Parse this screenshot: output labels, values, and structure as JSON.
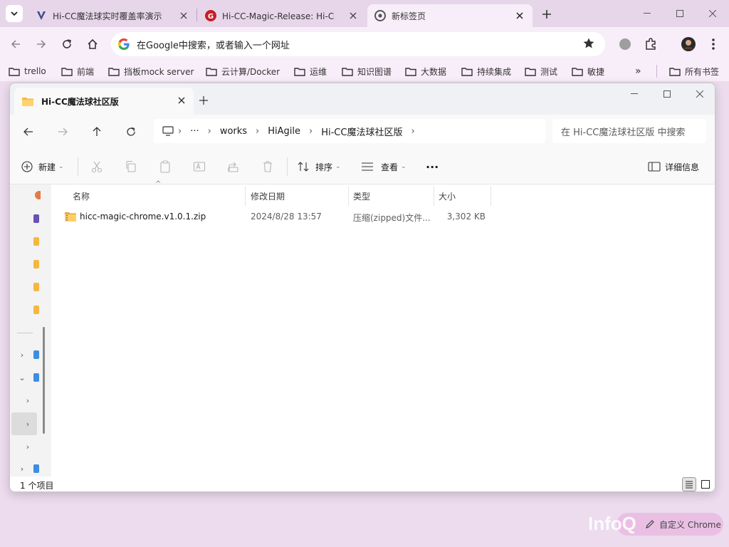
{
  "browser": {
    "tabs": [
      {
        "title": "Hi-CC魔法球实时覆盖率演示",
        "icon": "v-logo-icon",
        "color": "#3b4a8c"
      },
      {
        "title": "Hi-CC-Magic-Release: Hi-CC魔",
        "icon": "gitee-logo-icon",
        "color": "#c71d23"
      },
      {
        "title": "新标签页",
        "icon": "chrome-logo-icon",
        "color": "#555555"
      }
    ],
    "omnibox": {
      "text": "在Google中搜索，或者输入一个网址"
    },
    "bookmarks": [
      "trello",
      "前端",
      "挡板mock server",
      "云计算/Docker",
      "运维",
      "知识图谱",
      "大数据",
      "持续集成",
      "测试",
      "敏捷"
    ],
    "more_bookmarks": "»",
    "all_bookmarks": "所有书签",
    "accent": "#f8eef9"
  },
  "explorer": {
    "tab_title": "Hi-CC魔法球社区版",
    "breadcrumb": [
      "works",
      "HiAgile",
      "Hi-CC魔法球社区版"
    ],
    "breadcrumb_ellipsis": "···",
    "search_placeholder": "在 Hi-CC魔法球社区版 中搜索",
    "commands": {
      "new": "新建",
      "sort": "排序",
      "view": "查看",
      "more": "···",
      "details": "详细信息"
    },
    "columns": [
      "名称",
      "修改日期",
      "类型",
      "大小"
    ],
    "files": [
      {
        "name": "hicc-magic-chrome.v1.0.1.zip",
        "date": "2024/8/28 13:57",
        "type": "压缩(zipped)文件...",
        "size": "3,302 KB"
      }
    ],
    "status": "1 个项目"
  },
  "watermark": {
    "logo": "InfoQ",
    "text": "自定义 Chrome"
  }
}
